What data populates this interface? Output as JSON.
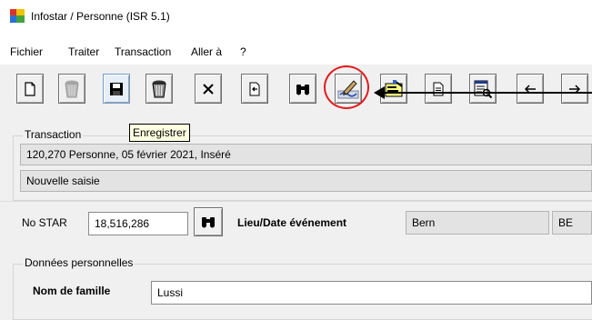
{
  "window": {
    "title": "Infostar / Personne (ISR 5.1)"
  },
  "menu": [
    "Fichier",
    "Traiter",
    "Transaction",
    "Aller à",
    "?"
  ],
  "toolbar": {
    "buttons": [
      {
        "icon": "new-document-icon"
      },
      {
        "icon": "trash-icon"
      },
      {
        "icon": "save-floppy-icon"
      },
      {
        "icon": "trash-icon"
      },
      {
        "icon": "close-x-icon"
      },
      {
        "icon": "import-icon"
      },
      {
        "icon": "binoculars-icon"
      },
      {
        "icon": "sign-pen-icon"
      },
      {
        "icon": "edit-card-icon"
      },
      {
        "icon": "document-icon"
      },
      {
        "icon": "search-list-icon"
      },
      {
        "icon": "arrow-left-icon"
      },
      {
        "icon": "arrow-right-icon"
      }
    ],
    "tooltip": "Enregistrer",
    "highlight_color": "#e31b1b"
  },
  "transaction": {
    "label": "Transaction",
    "info": "120,270  Personne, 05 février 2021, Inséré",
    "mode": "Nouvelle saisie"
  },
  "star": {
    "label": "No STAR",
    "value": "18,516,286",
    "event_label": "Lieu/Date événement",
    "place": "Bern",
    "canton": "BE"
  },
  "personal": {
    "section_label": "Données personnelles",
    "family_name_label": "Nom de famille",
    "family_name_value": "Lussi"
  }
}
